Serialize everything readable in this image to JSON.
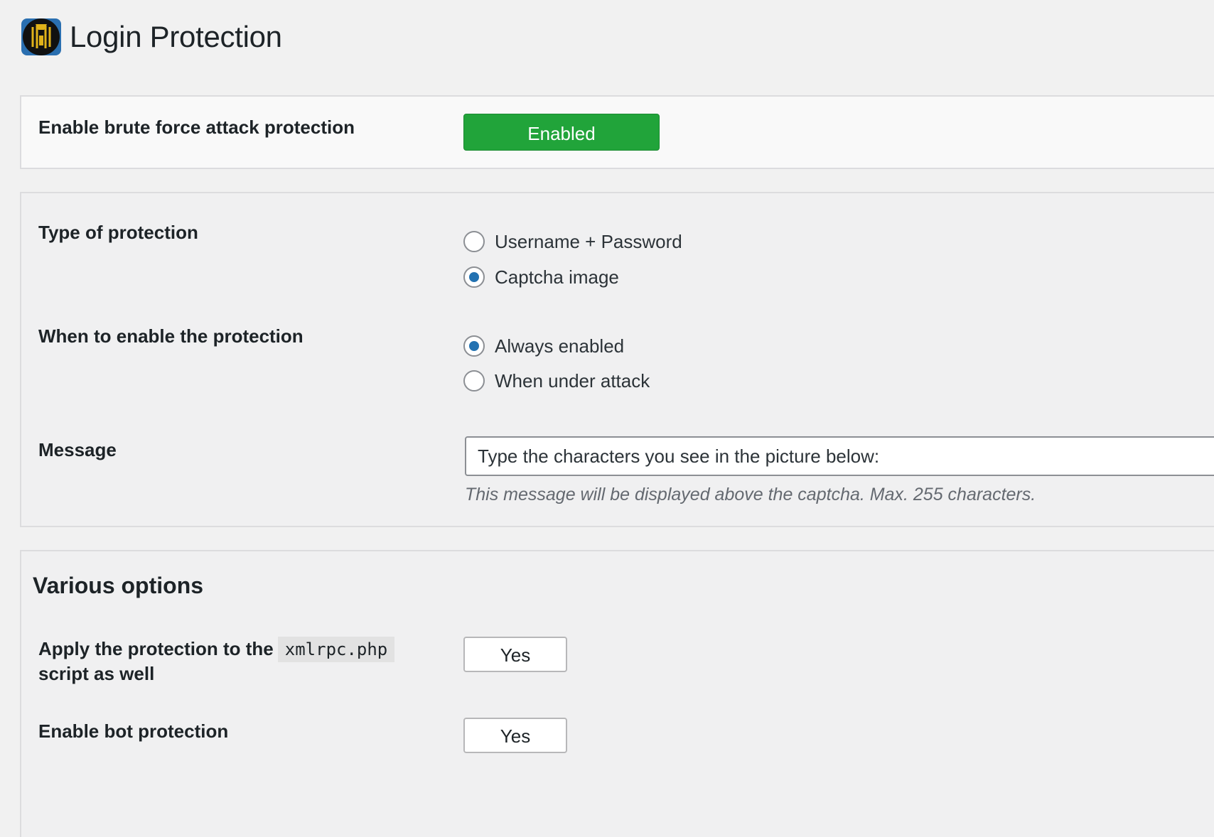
{
  "header": {
    "title": "Login Protection",
    "logo_icon": "shield-lock-logo-icon"
  },
  "brute_force": {
    "label": "Enable brute force attack protection",
    "toggle_label": "Enabled",
    "toggle_color": "#21a43a"
  },
  "protection": {
    "type_label": "Type of protection",
    "type_options": [
      {
        "label": "Username + Password",
        "checked": false
      },
      {
        "label": "Captcha image",
        "checked": true
      }
    ],
    "when_label": "When to enable the protection",
    "when_options": [
      {
        "label": "Always enabled",
        "checked": true
      },
      {
        "label": "When under attack",
        "checked": false
      }
    ],
    "message_label": "Message",
    "message_value": "Type the characters you see in the picture below:",
    "message_description": "This message will be displayed above the captcha. Max. 255 characters."
  },
  "various": {
    "title": "Various options",
    "xmlrpc_label_before": "Apply the protection to the",
    "xmlrpc_code": "xmlrpc.php",
    "xmlrpc_label_after": "script as well",
    "xmlrpc_button": "Yes",
    "bot_label": "Enable bot protection",
    "bot_button": "Yes"
  },
  "colors": {
    "accent_radio": "#2271b1",
    "background": "#f1f1f1"
  }
}
